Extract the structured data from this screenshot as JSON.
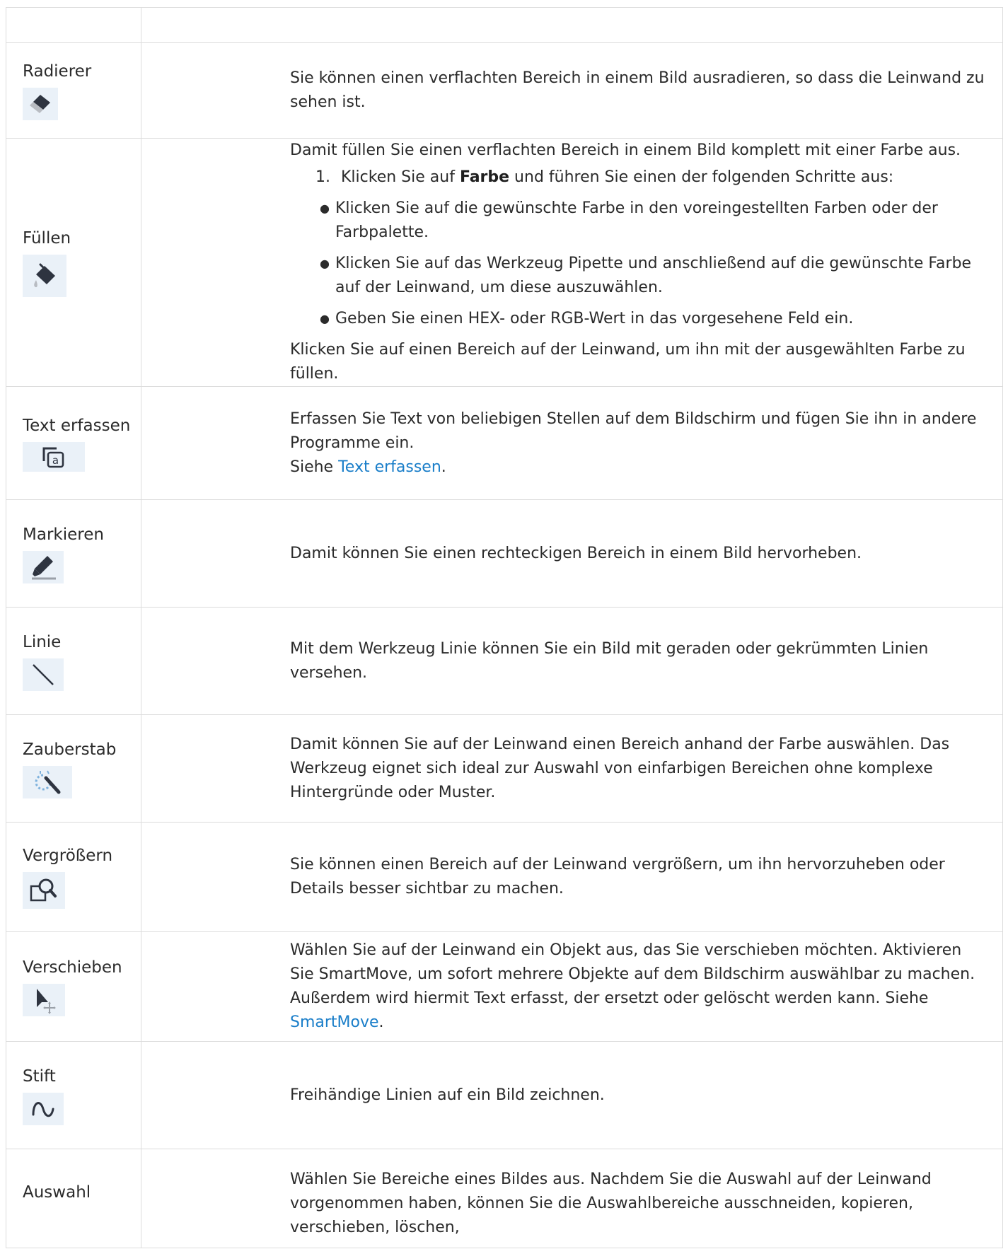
{
  "rows": [
    {
      "name": "",
      "icon": "",
      "desc": []
    },
    {
      "name": "Radierer",
      "icon": "eraser-icon",
      "desc": "Sie können einen verflachten Bereich in einem Bild ausradieren, so dass die Leinwand zu sehen ist."
    },
    {
      "name": "Füllen",
      "icon": "fill-bucket-icon",
      "intro": "Damit füllen Sie einen verflachten Bereich in einem Bild komplett mit einer Farbe aus.",
      "step_number": "1.",
      "step_before": "Klicken Sie auf ",
      "step_bold": "Farbe",
      "step_after": " und führen Sie einen der folgenden Schritte aus:",
      "bullets": [
        "Klicken Sie auf die gewünschte Farbe in den voreingestellten Farben oder der Farbpalette.",
        "Klicken Sie auf das Werkzeug Pipette und anschließend auf die gewünschte Farbe auf der Leinwand, um diese auszuwählen.",
        "Geben Sie einen HEX- oder RGB-Wert in das vorgesehene Feld ein."
      ],
      "outro": "Klicken Sie auf einen Bereich auf der Leinwand, um ihn mit der ausgewählten Farbe zu füllen."
    },
    {
      "name": "Text erfassen",
      "icon": "text-capture-icon",
      "desc": "Erfassen Sie Text von beliebigen Stellen auf dem Bildschirm und fügen Sie ihn in andere Programme ein.",
      "see_prefix": "Siehe ",
      "see_link": "Text erfassen",
      "see_suffix": "."
    },
    {
      "name": "Markieren",
      "icon": "highlighter-icon",
      "desc": "Damit können Sie einen rechteckigen Bereich in einem Bild hervorheben."
    },
    {
      "name": "Linie",
      "icon": "line-icon",
      "desc": "Mit dem Werkzeug Linie können Sie ein Bild mit geraden oder gekrümmten Linien versehen."
    },
    {
      "name": "Zauberstab",
      "icon": "magic-wand-icon",
      "desc": "Damit können Sie auf der Leinwand einen Bereich anhand der Farbe auswählen. Das Werkzeug eignet sich ideal zur Auswahl von einfarbigen Bereichen ohne komplexe Hintergründe oder Muster."
    },
    {
      "name": "Vergrößern",
      "icon": "magnify-icon",
      "desc": "Sie können einen Bereich auf der Leinwand vergrößern, um ihn hervorzuheben oder Details besser sichtbar zu machen."
    },
    {
      "name": "Verschieben",
      "icon": "move-icon",
      "desc": "Wählen Sie auf der Leinwand ein Objekt aus, das Sie verschieben möchten. Aktivieren Sie SmartMove, um sofort mehrere Objekte auf dem Bildschirm auswählbar zu machen. Außerdem wird hiermit Text erfasst, der ersetzt oder gelöscht werden kann. Siehe ",
      "see_link": "SmartMove",
      "see_suffix": "."
    },
    {
      "name": "Stift",
      "icon": "pen-icon",
      "desc": "Freihändige Linien auf ein Bild zeichnen."
    },
    {
      "name": "Auswahl",
      "icon": "",
      "desc": "Wählen Sie Bereiche eines Bildes aus. Nachdem Sie die Auswahl auf der Leinwand vorgenommen haben, können Sie die Auswahlbereiche ausschneiden, kopieren, verschieben, löschen,"
    }
  ],
  "colors": {
    "border": "#dcdcdc",
    "text": "#2b2b2b",
    "link": "#1a7ec9",
    "icon_bg": "#eaf1f8",
    "icon_fg": "#2e3440"
  }
}
